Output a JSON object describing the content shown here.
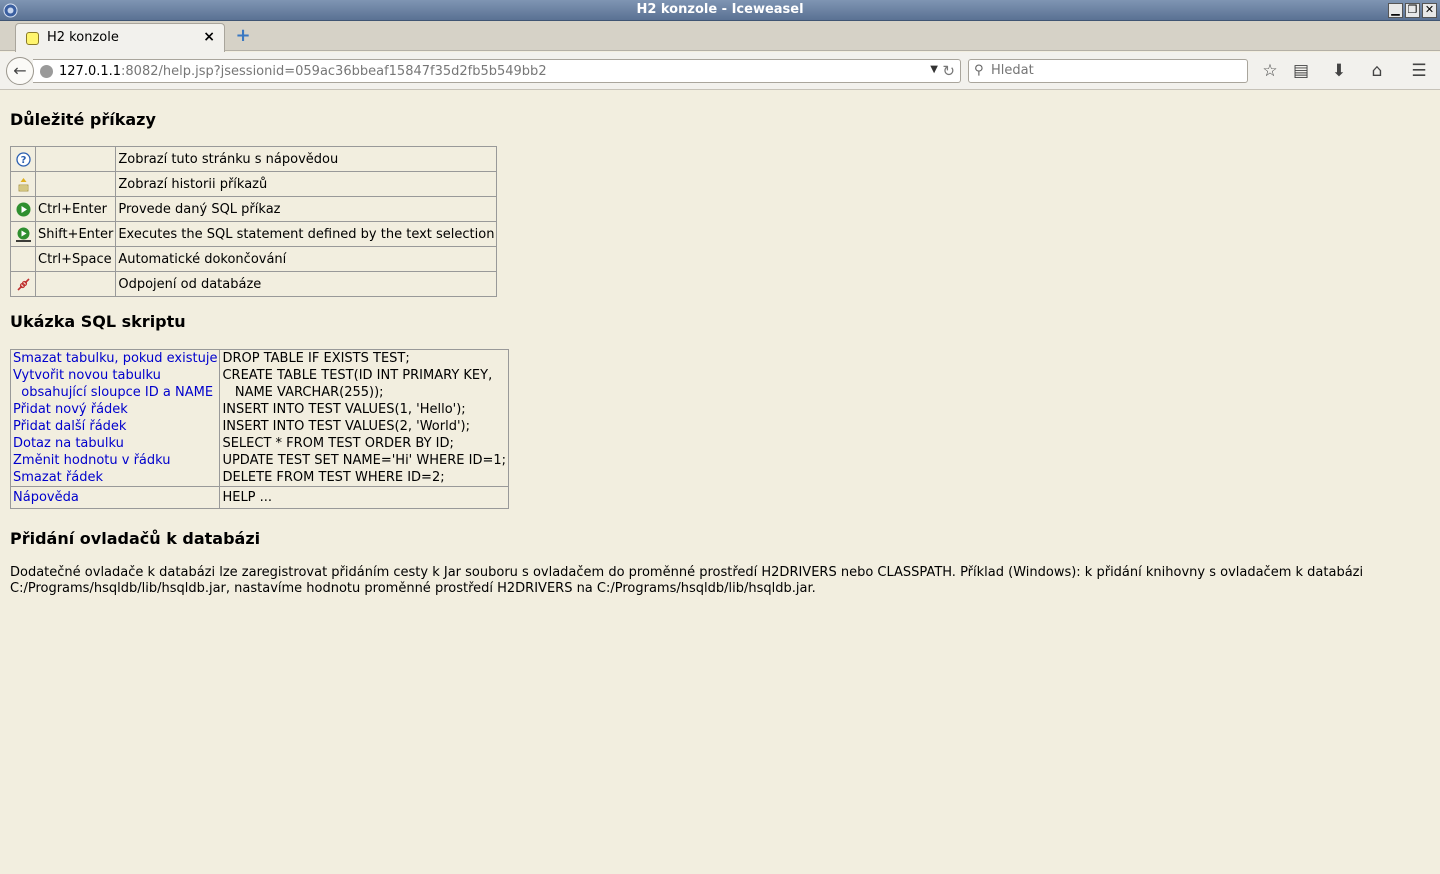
{
  "window": {
    "title": "H2 konzole - Iceweasel"
  },
  "tabs": [
    {
      "label": "H2 konzole",
      "close": "×"
    }
  ],
  "newtab": "+",
  "nav": {
    "url_host": "127.0.1.1",
    "url_rest": ":8082/help.jsp?jsessionid=059ac36bbeaf15847f35d2fb5b549bb2",
    "search_placeholder": "Hledat"
  },
  "page": {
    "h_commands": "Důležité příkazy",
    "commands": [
      {
        "icon": "help-icon",
        "key": "",
        "desc": "Zobrazí tuto stránku s nápovědou"
      },
      {
        "icon": "history-icon",
        "key": "",
        "desc": "Zobrazí historii příkazů"
      },
      {
        "icon": "run-icon",
        "key": "Ctrl+Enter",
        "desc": "Provede daný SQL příkaz"
      },
      {
        "icon": "run-selected-icon",
        "key": "Shift+Enter",
        "desc": "Executes the SQL statement defined by the text selection"
      },
      {
        "icon": "",
        "key": "Ctrl+Space",
        "desc": "Automatické dokončování"
      },
      {
        "icon": "disconnect-icon",
        "key": "",
        "desc": "Odpojení od databáze"
      }
    ],
    "h_sql": "Ukázka SQL skriptu",
    "sql_left": [
      "Smazat tabulku, pokud existuje",
      "Vytvořit novou tabulku",
      "  obsahující sloupce ID a NAME",
      "Přidat nový řádek",
      "Přidat další řádek",
      "Dotaz na tabulku",
      "Změnit hodnotu v řádku",
      "Smazat řádek"
    ],
    "sql_right": [
      "DROP TABLE IF EXISTS TEST;",
      "CREATE TABLE TEST(ID INT PRIMARY KEY,",
      "   NAME VARCHAR(255));",
      "INSERT INTO TEST VALUES(1, 'Hello');",
      "INSERT INTO TEST VALUES(2, 'World');",
      "SELECT * FROM TEST ORDER BY ID;",
      "UPDATE TEST SET NAME='Hi' WHERE ID=1;",
      "DELETE FROM TEST WHERE ID=2;"
    ],
    "help_link": "Nápověda",
    "help_cmd": "HELP ...",
    "h_drivers": "Přidání ovladačů k databázi",
    "drivers_text": "Dodatečné ovladače k databázi lze zaregistrovat přidáním cesty k Jar souboru s ovladačem do proměnné prostředí H2DRIVERS nebo CLASSPATH. Příklad (Windows): k přidání knihovny s ovladačem k databázi C:/Programs/hsqldb/lib/hsqldb.jar, nastavíme hodnotu proměnné prostředí H2DRIVERS na C:/Programs/hsqldb/lib/hsqldb.jar."
  }
}
